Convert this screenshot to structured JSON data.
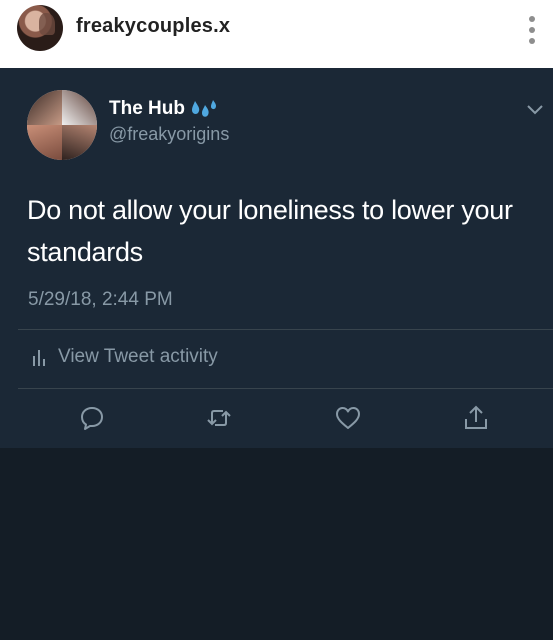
{
  "header": {
    "username": "freakycouples.x"
  },
  "tweet": {
    "display_name": "The Hub",
    "name_emoji": "sweat-droplets-icon",
    "handle": "@freakyorigins",
    "text": "Do not allow your loneliness to lower your standards",
    "timestamp": "5/29/18, 2:44 PM",
    "activity_label": "View Tweet activity"
  },
  "colors": {
    "card_bg": "#1b2836",
    "page_bg": "#141d26",
    "secondary_text": "#8899a6",
    "divider": "#38444d",
    "emoji_blue": "#4fa8e0"
  }
}
